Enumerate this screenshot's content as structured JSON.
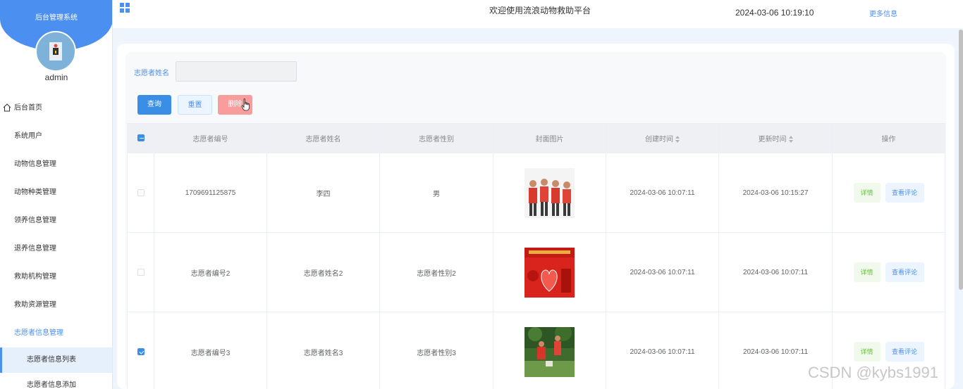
{
  "sidebar": {
    "title": "后台管理系统",
    "username": "admin",
    "menu": [
      {
        "label": "后台首页"
      },
      {
        "label": "系统用户"
      },
      {
        "label": "动物信息管理"
      },
      {
        "label": "动物种类管理"
      },
      {
        "label": "领养信息管理"
      },
      {
        "label": "退养信息管理"
      },
      {
        "label": "救助机构管理"
      },
      {
        "label": "救助资源管理"
      },
      {
        "label": "志愿者信息管理"
      }
    ],
    "submenu": [
      {
        "label": "志愿者信息列表"
      },
      {
        "label": "志愿者信息添加"
      }
    ]
  },
  "topbar": {
    "title": "欢迎使用流浪动物救助平台",
    "datetime": "2024-03-06 10:19:10",
    "more": "更多信息"
  },
  "search": {
    "label": "志愿者姓名",
    "value": ""
  },
  "buttons": {
    "query": "查询",
    "reset": "重置",
    "delete": "删除"
  },
  "table": {
    "columns": [
      "志愿者编号",
      "志愿者姓名",
      "志愿者性别",
      "封面图片",
      "创建时间",
      "更新时间",
      "操作"
    ],
    "rows": [
      {
        "id": "1709691125875",
        "name": "李四",
        "gender": "男",
        "created": "2024-03-06 10:07:11",
        "updated": "2024-03-06 10:15:27",
        "checked": false
      },
      {
        "id": "志愿者编号2",
        "name": "志愿者姓名2",
        "gender": "志愿者性别2",
        "created": "2024-03-06 10:07:11",
        "updated": "2024-03-06 10:07:11",
        "checked": false
      },
      {
        "id": "志愿者编号3",
        "name": "志愿者姓名3",
        "gender": "志愿者性别3",
        "created": "2024-03-06 10:07:11",
        "updated": "2024-03-06 10:07:11",
        "checked": true
      }
    ],
    "detail_label": "详情",
    "comment_label": "查看评论"
  },
  "watermark": "CSDN @kybs1991",
  "colors": {
    "accent": "#4b8ff0",
    "danger": "#f89c9c",
    "success": "#67c23a"
  }
}
